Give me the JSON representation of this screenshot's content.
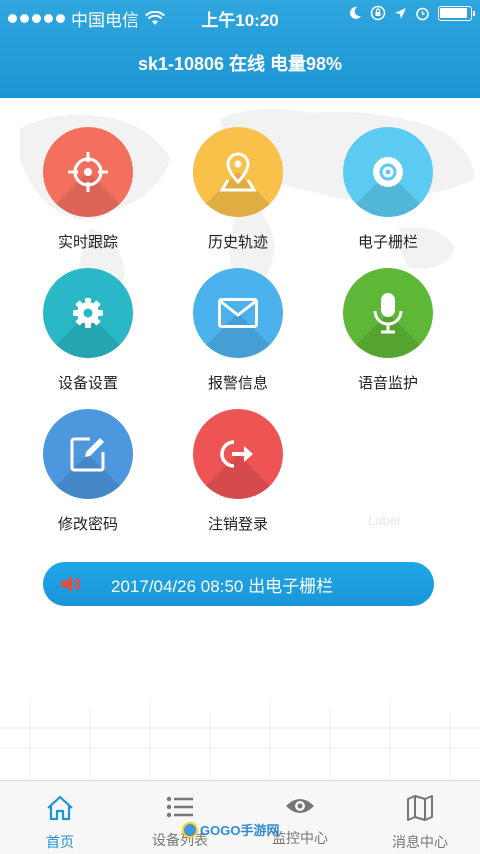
{
  "status_bar": {
    "carrier": "中国电信",
    "time": "上午10:20"
  },
  "header": {
    "title": "sk1-10806 在线 电量98%"
  },
  "grid": [
    {
      "label": "实时跟踪",
      "icon": "crosshair-icon",
      "color": "#f3705f"
    },
    {
      "label": "历史轨迹",
      "icon": "map-pin-icon",
      "color": "#f9c14a"
    },
    {
      "label": "电子栅栏",
      "icon": "disc-icon",
      "color": "#5ccbf2"
    },
    {
      "label": "设备设置",
      "icon": "gear-icon",
      "color": "#2ab8c6"
    },
    {
      "label": "报警信息",
      "icon": "envelope-icon",
      "color": "#4cb2ee"
    },
    {
      "label": "语音监护",
      "icon": "microphone-icon",
      "color": "#5fb737"
    },
    {
      "label": "修改密码",
      "icon": "edit-icon",
      "color": "#4c97de"
    },
    {
      "label": "注销登录",
      "icon": "logout-icon",
      "color": "#ee5454"
    }
  ],
  "ghost_label": "Label",
  "alert": {
    "text": "2017/04/26 08:50 出电子栅栏",
    "icon": "speaker-icon"
  },
  "tabbar": [
    {
      "label": "首页",
      "icon": "home-icon",
      "active": true
    },
    {
      "label": "设备列表",
      "icon": "list-icon",
      "active": false
    },
    {
      "label": "监控中心",
      "icon": "eye-icon",
      "active": false
    },
    {
      "label": "消息中心",
      "icon": "map-icon",
      "active": false
    }
  ],
  "watermark": "GOGO手游网"
}
